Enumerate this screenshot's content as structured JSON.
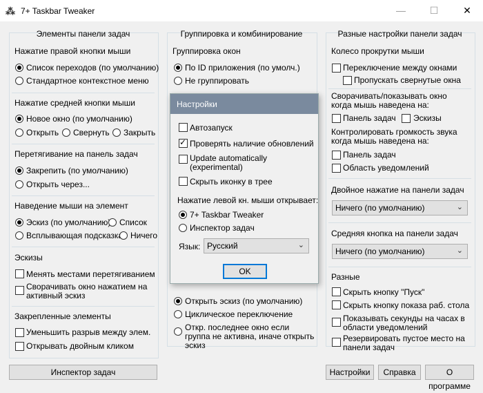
{
  "window": {
    "title": "7+ Taskbar Tweaker",
    "minimize": "—",
    "maximize": "☐",
    "close": "✕"
  },
  "left": {
    "title": "Элементы панели задач",
    "right_click": {
      "title": "Нажатие правой кнопки мыши",
      "opt1": "Список переходов (по умолчанию)",
      "opt2": "Стандартное контекстное меню"
    },
    "middle_click": {
      "title": "Нажатие средней кнопки мыши",
      "opt1": "Новое окно (по умолчанию)",
      "opt2": "Открыть",
      "opt3": "Свернуть",
      "opt4": "Закрыть"
    },
    "drag": {
      "title": "Перетягивание на панель задач",
      "opt1": "Закрепить (по умолчанию)",
      "opt2": "Открыть через..."
    },
    "hover": {
      "title": "Наведение мыши на элемент",
      "opt1": "Эскиз (по умолчанию)",
      "opt2": "Список",
      "opt3": "Всплывающая подсказка",
      "opt4": "Ничего"
    },
    "thumbs": {
      "title": "Эскизы",
      "opt1": "Менять местами перетягиванием",
      "opt2": "Сворачивать окно нажатием на активный эскиз"
    },
    "pinned": {
      "title": "Закрепленные элементы",
      "opt1": "Уменьшить разрыв между элем.",
      "opt2": "Открывать двойным кликом"
    },
    "inspector_button": "Инспектор задач"
  },
  "middle": {
    "title": "Группировка и комбинирование",
    "grouping": {
      "title": "Группировка окон",
      "opt1": "По ID приложения (по умолч.)",
      "opt2": "Не группировать"
    },
    "clicking": {
      "opt1": "Открыть эскиз (по умолчанию)",
      "opt2": "Циклическое переключение",
      "opt3": "Откр. последнее окно если группа не активна, иначе открыть эскиз"
    }
  },
  "right": {
    "title": "Разные настройки панели задач",
    "wheel": {
      "title": "Колесо прокрутки мыши",
      "opt1": "Переключение между окнами",
      "opt2": "Пропускать свернутые окна"
    },
    "minimize_hover": {
      "title": "Сворачивать/показывать окно когда мышь наведена на:",
      "opt1": "Панель задач",
      "opt2": "Эскизы"
    },
    "volume": {
      "title": "Контролировать громкость звука когда мышь наведена на:",
      "opt1": "Панель задач",
      "opt2": "Область уведомлений"
    },
    "double_click": {
      "title": "Двойное нажатие на панели задач",
      "value": "Ничего (по умолчанию)"
    },
    "middle_click": {
      "title": "Средняя кнопка на панели задач",
      "value": "Ничего (по умолчанию)"
    },
    "misc": {
      "title": "Разные",
      "opt1": "Скрыть кнопку \"Пуск\"",
      "opt2": "Скрыть кнопку показа раб. стола",
      "opt3": "Показывать секунды на часах в области уведомлений",
      "opt4": "Резервировать пустое место на панели задач"
    }
  },
  "buttons": {
    "settings": "Настройки",
    "help": "Справка",
    "about": "О программе"
  },
  "dialog": {
    "title": "Настройки",
    "autostart": "Автозапуск",
    "check_updates": "Проверять наличие обновлений",
    "update_auto": "Update automatically (experimental)",
    "hide_tray": "Скрыть иконку в трее",
    "left_click_title": "Нажатие левой кн. мыши открывает:",
    "left_opt1": "7+ Taskbar Tweaker",
    "left_opt2": "Инспектор задач",
    "language_label": "Язык:",
    "language_value": "Русский",
    "ok": "OK"
  }
}
